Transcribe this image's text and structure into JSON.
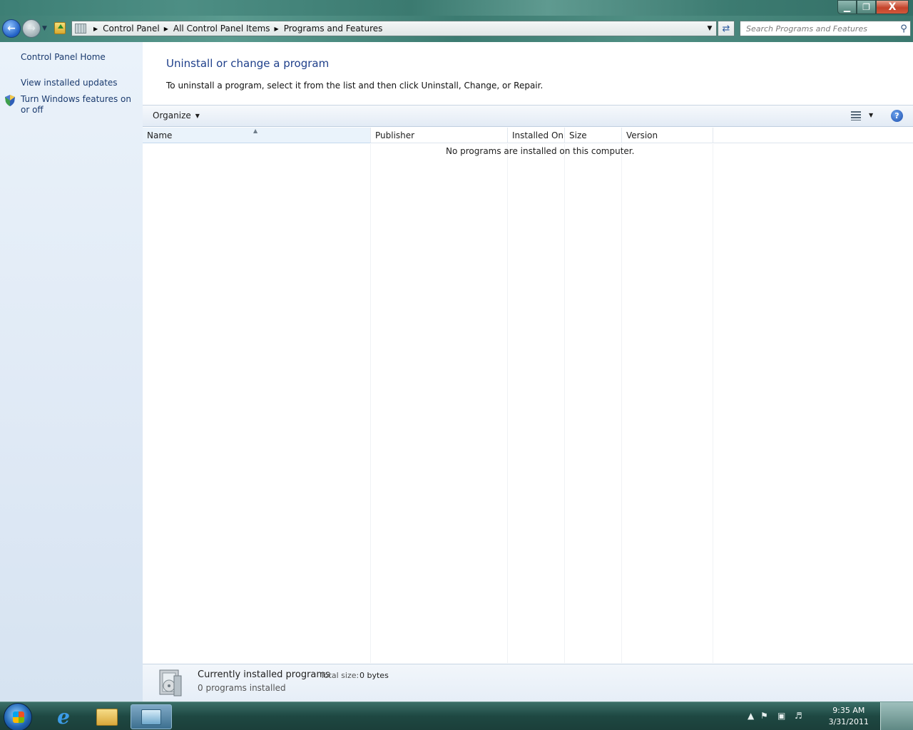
{
  "window": {
    "caption_buttons": {
      "minimize": "▁",
      "maximize": "❐",
      "close": "X"
    }
  },
  "navigation": {
    "breadcrumbs": [
      "Control Panel",
      "All Control Panel Items",
      "Programs and Features"
    ],
    "search_placeholder": "Search Programs and Features"
  },
  "left_pane": {
    "links": [
      "Control Panel Home",
      "View installed updates",
      "Turn Windows features on or off"
    ]
  },
  "main": {
    "title": "Uninstall or change a program",
    "description": "To uninstall a program, select it from the list and then click Uninstall, Change, or Repair.",
    "toolbar": {
      "organize": "Organize"
    },
    "columns": [
      "Name",
      "Publisher",
      "Installed On",
      "Size",
      "Version"
    ],
    "empty_message": "No programs are installed on this computer."
  },
  "details": {
    "title": "Currently installed programs",
    "total_size_label": "Total size:",
    "total_size": "0 bytes",
    "count": "0 programs installed"
  },
  "taskbar": {
    "time": "9:35 AM",
    "date": "3/31/2011"
  },
  "colors": {
    "link": "#1a3a6e",
    "heading": "#1e3f8a",
    "glass": "#3c7b71"
  }
}
